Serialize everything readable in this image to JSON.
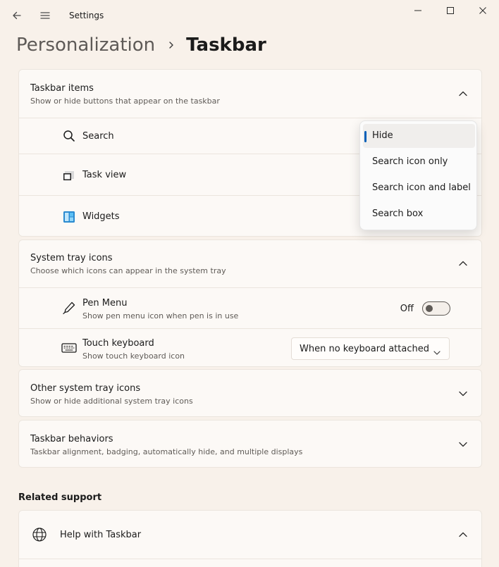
{
  "window": {
    "title": "Settings"
  },
  "breadcrumb": {
    "parent": "Personalization",
    "current": "Taskbar"
  },
  "taskbar_items": {
    "title": "Taskbar items",
    "subtitle": "Show or hide buttons that appear on the taskbar",
    "items": [
      {
        "label": "Search",
        "icon": "search-icon"
      },
      {
        "label": "Task view",
        "icon": "task-view-icon"
      },
      {
        "label": "Widgets",
        "icon": "widgets-icon"
      }
    ]
  },
  "search_dropdown": {
    "options": [
      "Hide",
      "Search icon only",
      "Search icon and label",
      "Search box"
    ],
    "selected": "Hide"
  },
  "system_tray": {
    "title": "System tray icons",
    "subtitle": "Choose which icons can appear in the system tray",
    "pen_menu": {
      "title": "Pen Menu",
      "subtitle": "Show pen menu icon when pen is in use",
      "state": "Off",
      "icon": "pen-icon"
    },
    "touch_keyboard": {
      "title": "Touch keyboard",
      "subtitle": "Show touch keyboard icon",
      "value": "When no keyboard attached",
      "icon": "keyboard-icon"
    }
  },
  "other_tray": {
    "title": "Other system tray icons",
    "subtitle": "Show or hide additional system tray icons"
  },
  "behaviors": {
    "title": "Taskbar behaviors",
    "subtitle": "Taskbar alignment, badging, automatically hide, and multiple displays"
  },
  "related": {
    "heading": "Related support",
    "help_title": "Help with Taskbar",
    "icon": "globe-icon"
  },
  "colors": {
    "accent": "#005fb8",
    "background": "#f8f1ea",
    "card": "#fcf9f6"
  }
}
